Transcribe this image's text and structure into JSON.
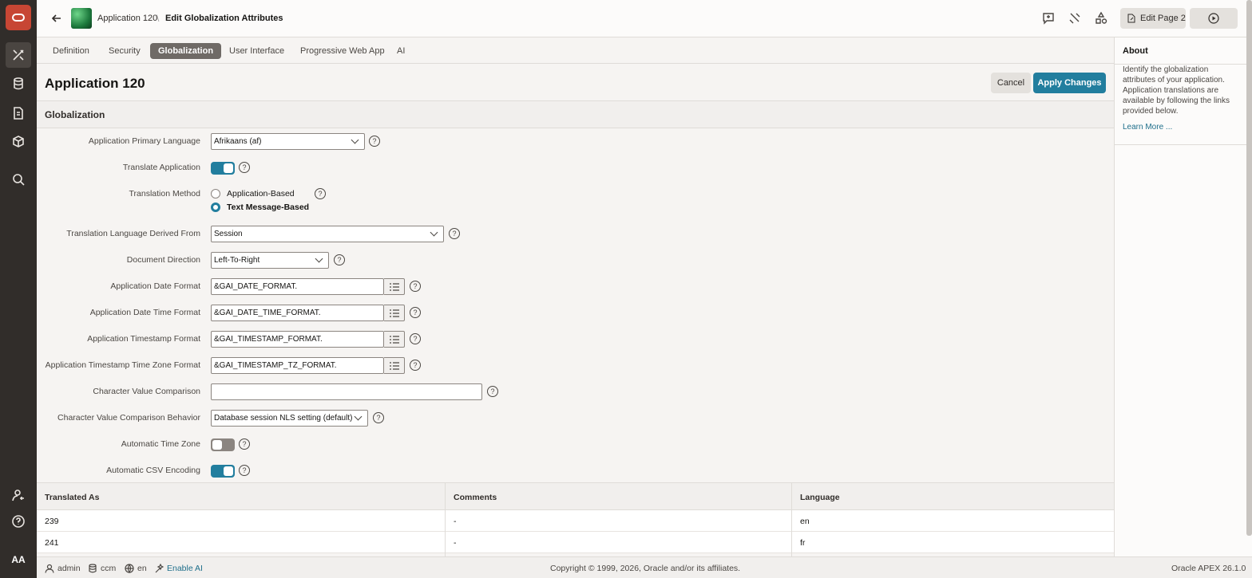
{
  "header": {
    "crumb_app": "Application 120",
    "crumb_page": "Edit Globalization Attributes",
    "edit_page_label": "Edit Page 2"
  },
  "tabs": [
    {
      "label": "Definition"
    },
    {
      "label": "Security"
    },
    {
      "label": "Globalization"
    },
    {
      "label": "User Interface"
    },
    {
      "label": "Progressive Web App"
    },
    {
      "label": "AI"
    }
  ],
  "page": {
    "title": "Application 120",
    "cancel_label": "Cancel",
    "apply_label": "Apply Changes",
    "region_title": "Globalization"
  },
  "form": {
    "primary_language": {
      "label": "Application Primary Language",
      "value": "Afrikaans (af)"
    },
    "translate_app": {
      "label": "Translate Application",
      "on": true
    },
    "translation_method": {
      "label": "Translation Method",
      "options": [
        "Application-Based",
        "Text Message-Based"
      ],
      "selected": "Text Message-Based"
    },
    "lang_derived": {
      "label": "Translation Language Derived From",
      "value": "Session"
    },
    "doc_direction": {
      "label": "Document Direction",
      "value": "Left-To-Right"
    },
    "date_format": {
      "label": "Application Date Format",
      "value": "&GAI_DATE_FORMAT."
    },
    "date_time_format": {
      "label": "Application Date Time Format",
      "value": "&GAI_DATE_TIME_FORMAT."
    },
    "timestamp_format": {
      "label": "Application Timestamp Format",
      "value": "&GAI_TIMESTAMP_FORMAT."
    },
    "timestamp_tz_format": {
      "label": "Application Timestamp Time Zone Format",
      "value": "&GAI_TIMESTAMP_TZ_FORMAT."
    },
    "char_compare": {
      "label": "Character Value Comparison",
      "value": ""
    },
    "char_compare_behavior": {
      "label": "Character Value Comparison Behavior",
      "value": "Database session NLS setting (default)"
    },
    "auto_tz": {
      "label": "Automatic Time Zone",
      "on": false
    },
    "auto_csv": {
      "label": "Automatic CSV Encoding",
      "on": true
    }
  },
  "table": {
    "headers": [
      "Translated As",
      "Comments",
      "Language"
    ],
    "rows": [
      [
        "239",
        "-",
        "en"
      ],
      [
        "241",
        "-",
        "fr"
      ]
    ]
  },
  "about": {
    "title": "About",
    "text": "Identify the globalization attributes of your application. Application translations are available by following the links provided below.",
    "link": "Learn More ..."
  },
  "footer": {
    "user": "admin",
    "schema": "ccm",
    "lang": "en",
    "enable_ai": "Enable AI",
    "copyright": "Copyright © 1999, 2026, Oracle and/or its affiliates.",
    "version": "Oracle APEX 26.1.0"
  },
  "colors": {
    "accent": "#227e9e",
    "nav_bg": "#312d2a",
    "oracle_red": "#c74634"
  }
}
